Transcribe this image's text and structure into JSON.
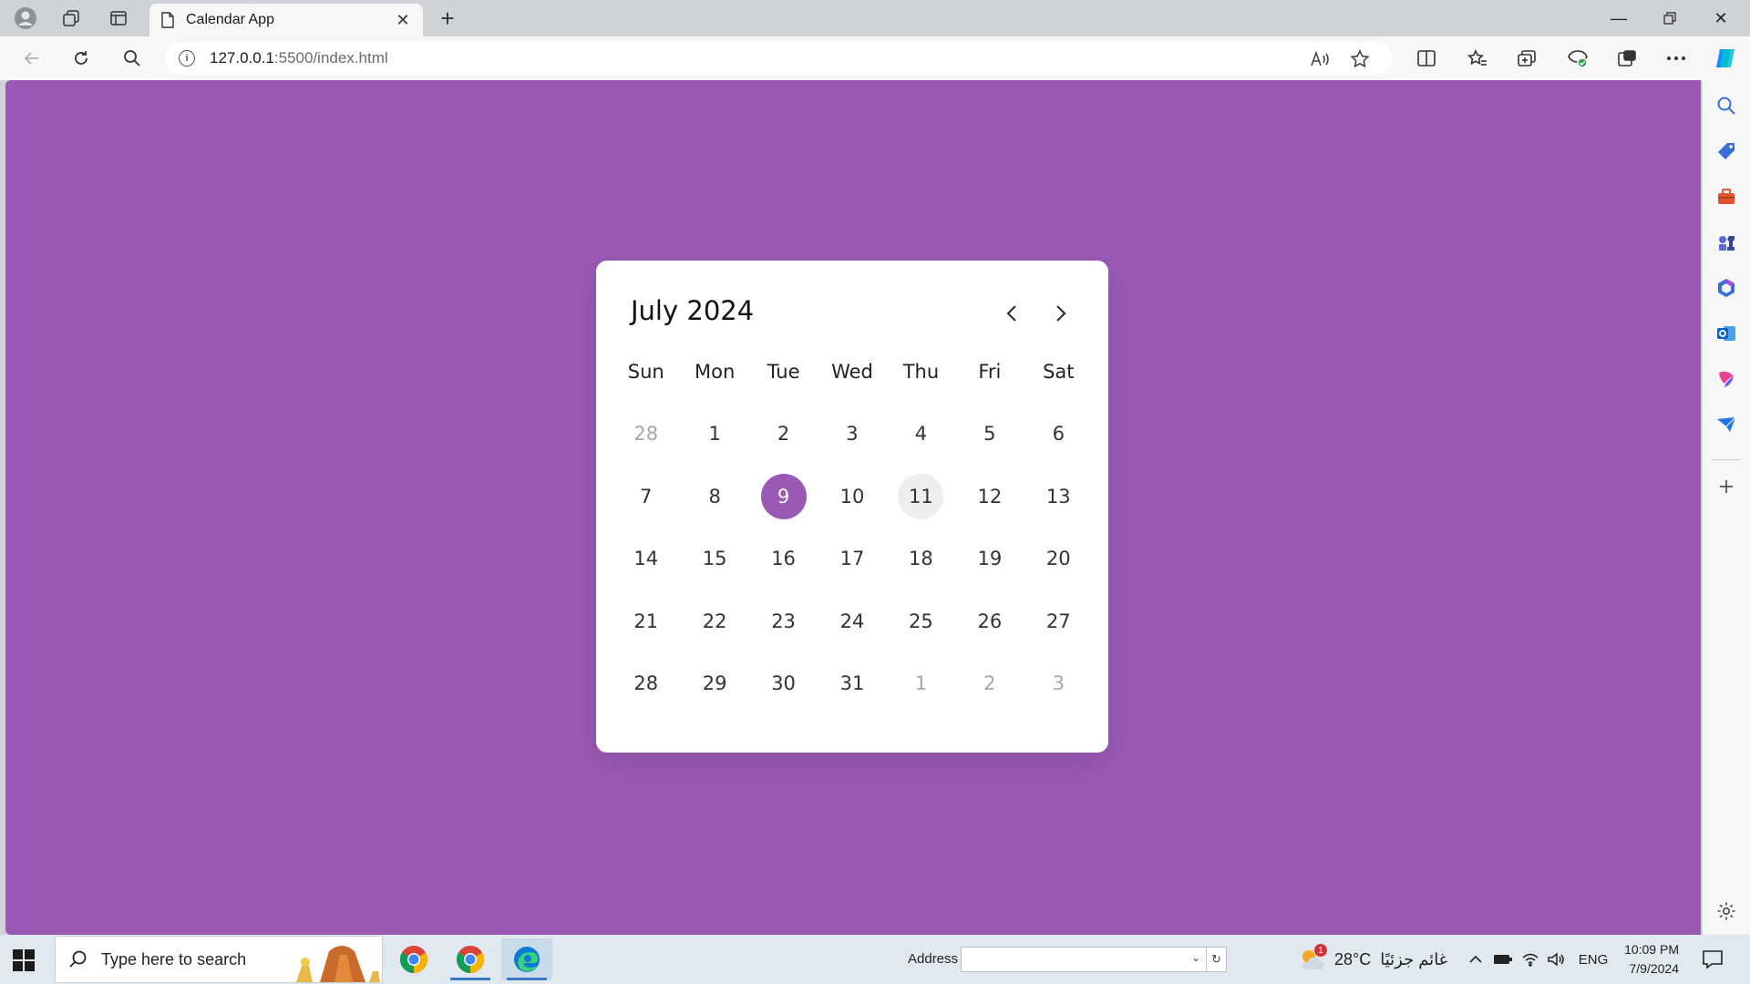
{
  "browser": {
    "tab_title": "Calendar App",
    "url_host": "127.0.0.1",
    "url_rest": ":5500/index.html"
  },
  "calendar": {
    "title": "July 2024",
    "weekdays": [
      "Sun",
      "Mon",
      "Tue",
      "Wed",
      "Thu",
      "Fri",
      "Sat"
    ],
    "days": [
      {
        "label": "28",
        "inactive": true
      },
      {
        "label": "1"
      },
      {
        "label": "2"
      },
      {
        "label": "3"
      },
      {
        "label": "4"
      },
      {
        "label": "5"
      },
      {
        "label": "6"
      },
      {
        "label": "7"
      },
      {
        "label": "8"
      },
      {
        "label": "9",
        "active": true
      },
      {
        "label": "10"
      },
      {
        "label": "11",
        "hover": true
      },
      {
        "label": "12"
      },
      {
        "label": "13"
      },
      {
        "label": "14"
      },
      {
        "label": "15"
      },
      {
        "label": "16"
      },
      {
        "label": "17"
      },
      {
        "label": "18"
      },
      {
        "label": "19"
      },
      {
        "label": "20"
      },
      {
        "label": "21"
      },
      {
        "label": "22"
      },
      {
        "label": "23"
      },
      {
        "label": "24"
      },
      {
        "label": "25"
      },
      {
        "label": "26"
      },
      {
        "label": "27"
      },
      {
        "label": "28"
      },
      {
        "label": "29"
      },
      {
        "label": "30"
      },
      {
        "label": "31"
      },
      {
        "label": "1",
        "inactive": true
      },
      {
        "label": "2",
        "inactive": true
      },
      {
        "label": "3",
        "inactive": true
      }
    ],
    "accent_color": "#9b59b6"
  },
  "taskbar": {
    "search_placeholder": "Type here to search",
    "address_label": "Address",
    "weather_temp": "28°C",
    "weather_condition": "غائم جزئيًا",
    "weather_badge": "1",
    "language": "ENG",
    "time": "10:09 PM",
    "date": "7/9/2024"
  }
}
